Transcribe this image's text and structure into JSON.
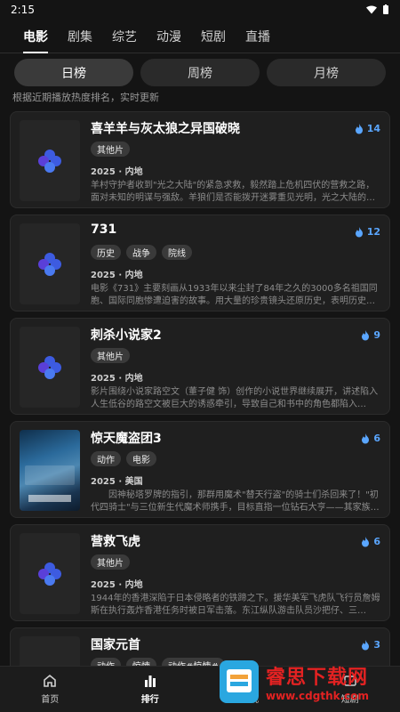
{
  "status": {
    "time": "2:15"
  },
  "tabs": [
    {
      "label": "电影",
      "active": true
    },
    {
      "label": "剧集"
    },
    {
      "label": "综艺"
    },
    {
      "label": "动漫"
    },
    {
      "label": "短剧"
    },
    {
      "label": "直播"
    }
  ],
  "segments": [
    "日榜",
    "周榜",
    "月榜"
  ],
  "hint": "根据近期播放热度排名，实时更新",
  "items": [
    {
      "title": "喜羊羊与灰太狼之异国破晓",
      "heat": "14",
      "tags": [
        "其他片"
      ],
      "meta": "2025 · 内地",
      "desc": "羊村守护者收到\"光之大陆\"的紧急求救，毅然踏上危机四伏的营救之路，面对未知的明谋与强敌。羊狼们是否能拨开迷雾重见光明，光之大陆的…"
    },
    {
      "title": "731",
      "heat": "12",
      "tags": [
        "历史",
        "战争",
        "院线"
      ],
      "meta": "2025 · 内地",
      "desc": "电影《731》主要刻画从1933年以来尘封了84年之久的3000多名祖国同胞、国际同胞惨遭迫害的故事。用大量的珍贵镜头还原历史，表明历史…"
    },
    {
      "title": "刺杀小说家2",
      "heat": "9",
      "tags": [
        "其他片"
      ],
      "meta": "2025 · 内地",
      "desc": "影片围绕小说家路空文（董子健 饰）创作的小说世界继续展开，讲述陷入人生低谷的路空文被巨大的诱惑牵引，导致自己和书中的角色都陷入…"
    },
    {
      "title": "惊天魔盗团3",
      "heat": "6",
      "tags": [
        "动作",
        "电影"
      ],
      "meta": "2025 · 美国",
      "desc": "　　因神秘塔罗牌的指引，那群用魔术\"替天行盗\"的骑士们杀回来了！\"初代四骑士\"与三位新生代魔术师携手，目标直指一位钻石大亨——其家族…",
      "poster": true
    },
    {
      "title": "营救飞虎",
      "heat": "6",
      "tags": [
        "其他片"
      ],
      "meta": "2025 · 内地",
      "desc": "1944年的香港深陷于日本侵略者的铁蹄之下。援华美军飞虎队飞行员詹姆斯在执行轰炸香港任务时被日军击落。东江纵队游击队员沙把仔、三…"
    },
    {
      "title": "国家元首",
      "heat": "3",
      "tags": [
        "动作",
        "惊悚",
        "动作#惊悚#"
      ],
      "meta": "",
      "desc": ""
    }
  ],
  "nav": [
    {
      "label": "首页",
      "icon": "home-icon"
    },
    {
      "label": "排行",
      "icon": "rank-icon",
      "active": true
    },
    {
      "label": "发现",
      "icon": "compass-icon"
    },
    {
      "label": "短剧",
      "icon": "video-icon"
    }
  ],
  "watermark": {
    "title": "睿思下载网",
    "url": "www.cdgthk.com"
  },
  "colors": {
    "accent": "#5aa6ff",
    "background": "#141414",
    "card": "#1f1f1f"
  }
}
